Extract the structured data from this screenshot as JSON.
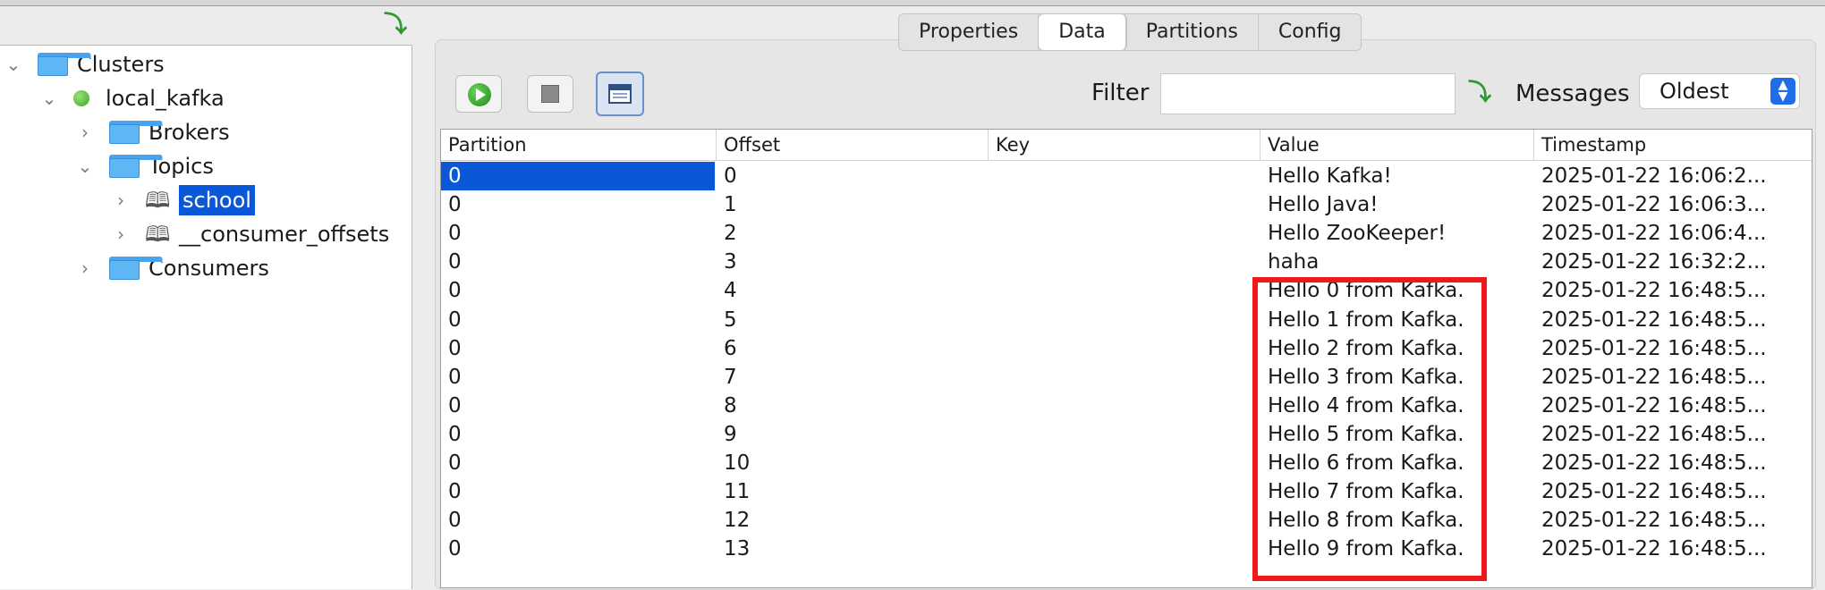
{
  "tree": {
    "collapse_icon": "download-arrow-icon",
    "items": [
      {
        "label": "Clusters",
        "icon": "folder-icon",
        "expanded": true
      },
      {
        "label": "local_kafka",
        "icon": "green-status-dot-icon",
        "expanded": true
      },
      {
        "label": "Brokers",
        "icon": "folder-icon",
        "expanded": false
      },
      {
        "label": "Topics",
        "icon": "folder-icon",
        "expanded": true
      },
      {
        "label": "school",
        "icon": "book-icon",
        "expanded": false,
        "selected": true
      },
      {
        "label": "__consumer_offsets",
        "icon": "book-icon",
        "expanded": false
      },
      {
        "label": "Consumers",
        "icon": "folder-icon",
        "expanded": false
      }
    ]
  },
  "tabs": [
    {
      "label": "Properties",
      "active": false
    },
    {
      "label": "Data",
      "active": true
    },
    {
      "label": "Partitions",
      "active": false
    },
    {
      "label": "Config",
      "active": false
    }
  ],
  "toolbar": {
    "run_icon": "play-icon",
    "stop_icon": "stop-icon",
    "view_icon": "window-view-icon",
    "filter_label": "Filter",
    "filter_value": "",
    "apply_icon": "download-arrow-icon",
    "messages_label": "Messages",
    "messages_value": "Oldest"
  },
  "table": {
    "columns": [
      "Partition",
      "Offset",
      "Key",
      "Value",
      "Timestamp"
    ],
    "rows": [
      [
        "0",
        "0",
        "",
        "Hello Kafka!",
        "2025-01-22 16:06:2..."
      ],
      [
        "0",
        "1",
        "",
        "Hello Java!",
        "2025-01-22 16:06:3..."
      ],
      [
        "0",
        "2",
        "",
        "Hello ZooKeeper!",
        "2025-01-22 16:06:4..."
      ],
      [
        "0",
        "3",
        "",
        "haha",
        "2025-01-22 16:32:2..."
      ],
      [
        "0",
        "4",
        "",
        "Hello 0 from Kafka.",
        "2025-01-22 16:48:5..."
      ],
      [
        "0",
        "5",
        "",
        "Hello 1 from Kafka.",
        "2025-01-22 16:48:5..."
      ],
      [
        "0",
        "6",
        "",
        "Hello 2 from Kafka.",
        "2025-01-22 16:48:5..."
      ],
      [
        "0",
        "7",
        "",
        "Hello 3 from Kafka.",
        "2025-01-22 16:48:5..."
      ],
      [
        "0",
        "8",
        "",
        "Hello 4 from Kafka.",
        "2025-01-22 16:48:5..."
      ],
      [
        "0",
        "9",
        "",
        "Hello 5 from Kafka.",
        "2025-01-22 16:48:5..."
      ],
      [
        "0",
        "10",
        "",
        "Hello 6 from Kafka.",
        "2025-01-22 16:48:5..."
      ],
      [
        "0",
        "11",
        "",
        "Hello 7 from Kafka.",
        "2025-01-22 16:48:5..."
      ],
      [
        "0",
        "12",
        "",
        "Hello 8 from Kafka.",
        "2025-01-22 16:48:5..."
      ],
      [
        "0",
        "13",
        "",
        "Hello 9 from Kafka.",
        "2025-01-22 16:48:5..."
      ]
    ],
    "selected_cell": {
      "row": 0,
      "col": 0
    }
  },
  "annotation": {
    "color": "#f01818",
    "rows_highlighted": [
      "4",
      "13"
    ],
    "column": "Value"
  }
}
